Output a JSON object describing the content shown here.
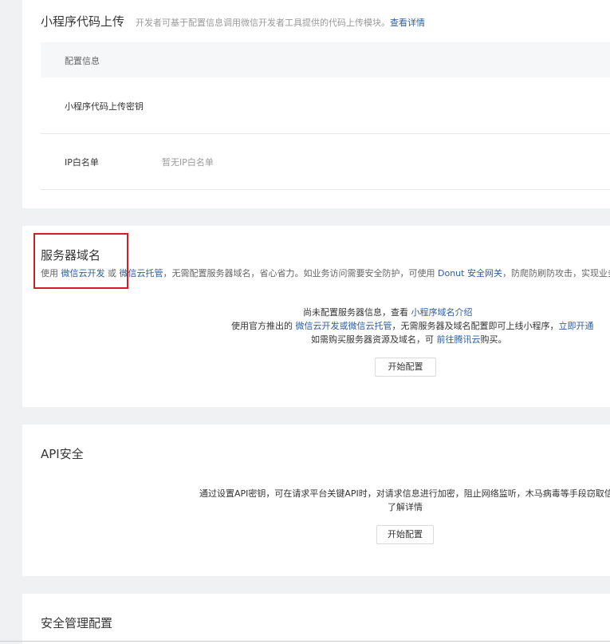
{
  "upload_section": {
    "title": "小程序代码上传",
    "desc_prefix": "开发者可基于配置信息调用微信开发者工具提供的代码上传模块。",
    "desc_link": "查看详情",
    "table_header": "配置信息",
    "rows": [
      {
        "label": "小程序代码上传密钥",
        "value": ""
      },
      {
        "label": "IP白名单",
        "value": "暂无IP白名单"
      }
    ]
  },
  "domain_section": {
    "title": "服务器域名",
    "sub": {
      "t1": "使用 ",
      "l1": "微信云开发",
      "t2": " 或 ",
      "l2": "微信云托管",
      "t3": "，无需配置服务器域名，省心省力。如业务访问需要安全防护，可使用 ",
      "l3": "Donut 安全网关",
      "t4": "，防爬防刷防攻击，实现业务安全"
    },
    "notice": {
      "line1_text": "尚未配置服务器信息，查看 ",
      "line1_link": "小程序域名介绍",
      "line2_text1": "使用官方推出的 ",
      "line2_link1": "微信云开发或微信云托管",
      "line2_text2": "，无需服务器及域名配置即可上线小程序，",
      "line2_link2": "立即开通",
      "line3_text1": "如需购买服务器资源及域名，可 ",
      "line3_link": "前往腾讯云",
      "line3_text2": "购买。"
    },
    "button": "开始配置"
  },
  "api_section": {
    "title": "API安全",
    "desc": "通过设置API密钥，可在请求平台关键API时，对请求信息进行加密，阻止网络监听，木马病毒等手段窃取信息。",
    "link": "了解详情",
    "button": "开始配置"
  },
  "security_section": {
    "title": "安全管理配置"
  },
  "colors": {
    "link": "#2e5d9c",
    "highlight_box": "#cc1f28",
    "page_bg": "#f0f1f3"
  }
}
